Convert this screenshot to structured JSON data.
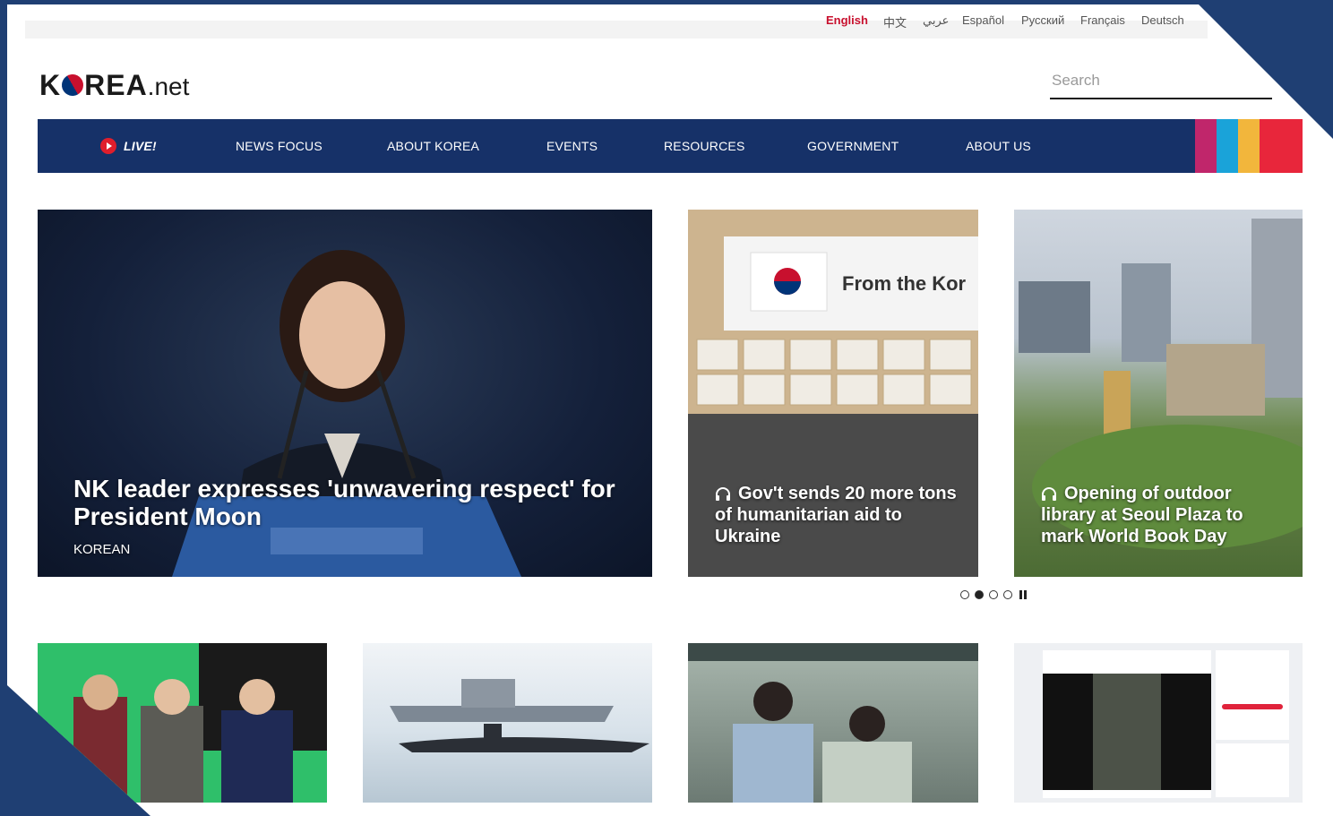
{
  "languages": [
    {
      "label": "English",
      "active": true
    },
    {
      "label": "中文",
      "active": false
    },
    {
      "label": "عربي",
      "active": false
    },
    {
      "label": "Español",
      "active": false
    },
    {
      "label": "Русский",
      "active": false
    },
    {
      "label": "Français",
      "active": false
    },
    {
      "label": "Deutsch",
      "active": false
    }
  ],
  "logo": {
    "brand": "K",
    "brand2": "REA",
    "suffix": ".net"
  },
  "search": {
    "placeholder": "Search"
  },
  "nav": {
    "live": "LIVE!",
    "items": [
      "NEWS FOCUS",
      "ABOUT KOREA",
      "EVENTS",
      "RESOURCES",
      "GOVERNMENT",
      "ABOUT US"
    ],
    "stripe_colors": [
      "#c0266b",
      "#1aa3d9",
      "#f2b63c",
      "#e8263b",
      "#e8263b"
    ]
  },
  "featured": {
    "main": {
      "headline": "NK leader expresses 'unwavering respect' for President Moon",
      "tag": "KOREAN"
    },
    "card2": {
      "headline": "Gov't sends 20 more tons of humanitarian aid to Ukraine",
      "image_text": "From the Kor"
    },
    "card3": {
      "headline": "Opening of outdoor library at Seoul Plaza to mark World Book Day"
    }
  },
  "carousel": {
    "dots": 4,
    "active_index": 1
  },
  "colors": {
    "nav_bg": "#163168",
    "accent_red": "#c8102e",
    "frame": "#1f3f73"
  }
}
